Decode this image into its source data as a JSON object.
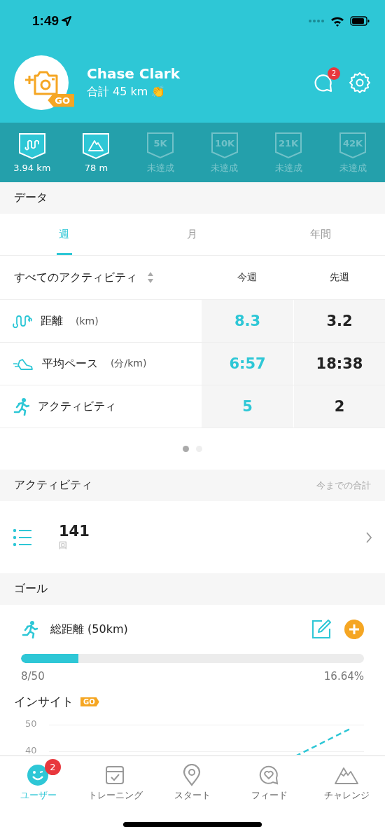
{
  "status_bar": {
    "time": "1:49"
  },
  "profile": {
    "name": "Chase Clark",
    "total": "合計 45 km 👏",
    "badge": "GO",
    "notifications": "2"
  },
  "achievements": [
    {
      "kind": "distance",
      "label": "3.94 km",
      "achieved": true
    },
    {
      "kind": "climb",
      "label": "78 m",
      "achieved": true
    },
    {
      "kind": "race",
      "mark": "5K",
      "label": "未達成",
      "achieved": false
    },
    {
      "kind": "race",
      "mark": "10K",
      "label": "未達成",
      "achieved": false
    },
    {
      "kind": "race",
      "mark": "21K",
      "label": "未達成",
      "achieved": false
    },
    {
      "kind": "race",
      "mark": "42K",
      "label": "未達成",
      "achieved": false
    }
  ],
  "data_section": {
    "title": "データ",
    "tabs": [
      {
        "label": "週",
        "selected": true
      },
      {
        "label": "月",
        "selected": false
      },
      {
        "label": "年間",
        "selected": false
      }
    ],
    "filter": "すべてのアクティビティ",
    "columns": [
      "今週",
      "先週"
    ],
    "rows": [
      {
        "kind": "distance",
        "label": "距離",
        "unit": "(km)",
        "this_week": "8.3",
        "last_week": "3.2"
      },
      {
        "kind": "pace",
        "label": "平均ペース",
        "unit": "(分/km)",
        "this_week": "6:57",
        "last_week": "18:38"
      },
      {
        "kind": "count",
        "label": "アクティビティ",
        "this_week": "5",
        "last_week": "2"
      }
    ],
    "pages": [
      {
        "selected": true
      },
      {
        "selected": false
      }
    ]
  },
  "activity_section": {
    "title": "アクティビティ",
    "note": "今までの合計",
    "count": "141",
    "unit": "回"
  },
  "goal_section": {
    "title": "ゴール",
    "goal": "総距離 (50km)",
    "level": 0.1664,
    "progress": "8/50",
    "percent": "16.64%"
  },
  "insight": {
    "title": "インサイト",
    "badge": "GO",
    "y_labels": [
      "50",
      "40"
    ]
  },
  "tab_bar": [
    {
      "kind": "user",
      "label": "ユーザー",
      "selected": true,
      "badge": "2"
    },
    {
      "kind": "training",
      "label": "トレーニング",
      "selected": false
    },
    {
      "kind": "start",
      "label": "スタート",
      "selected": false
    },
    {
      "kind": "feed",
      "label": "フィード",
      "selected": false
    },
    {
      "kind": "challenge",
      "label": "チャレンジ",
      "selected": false
    }
  ]
}
